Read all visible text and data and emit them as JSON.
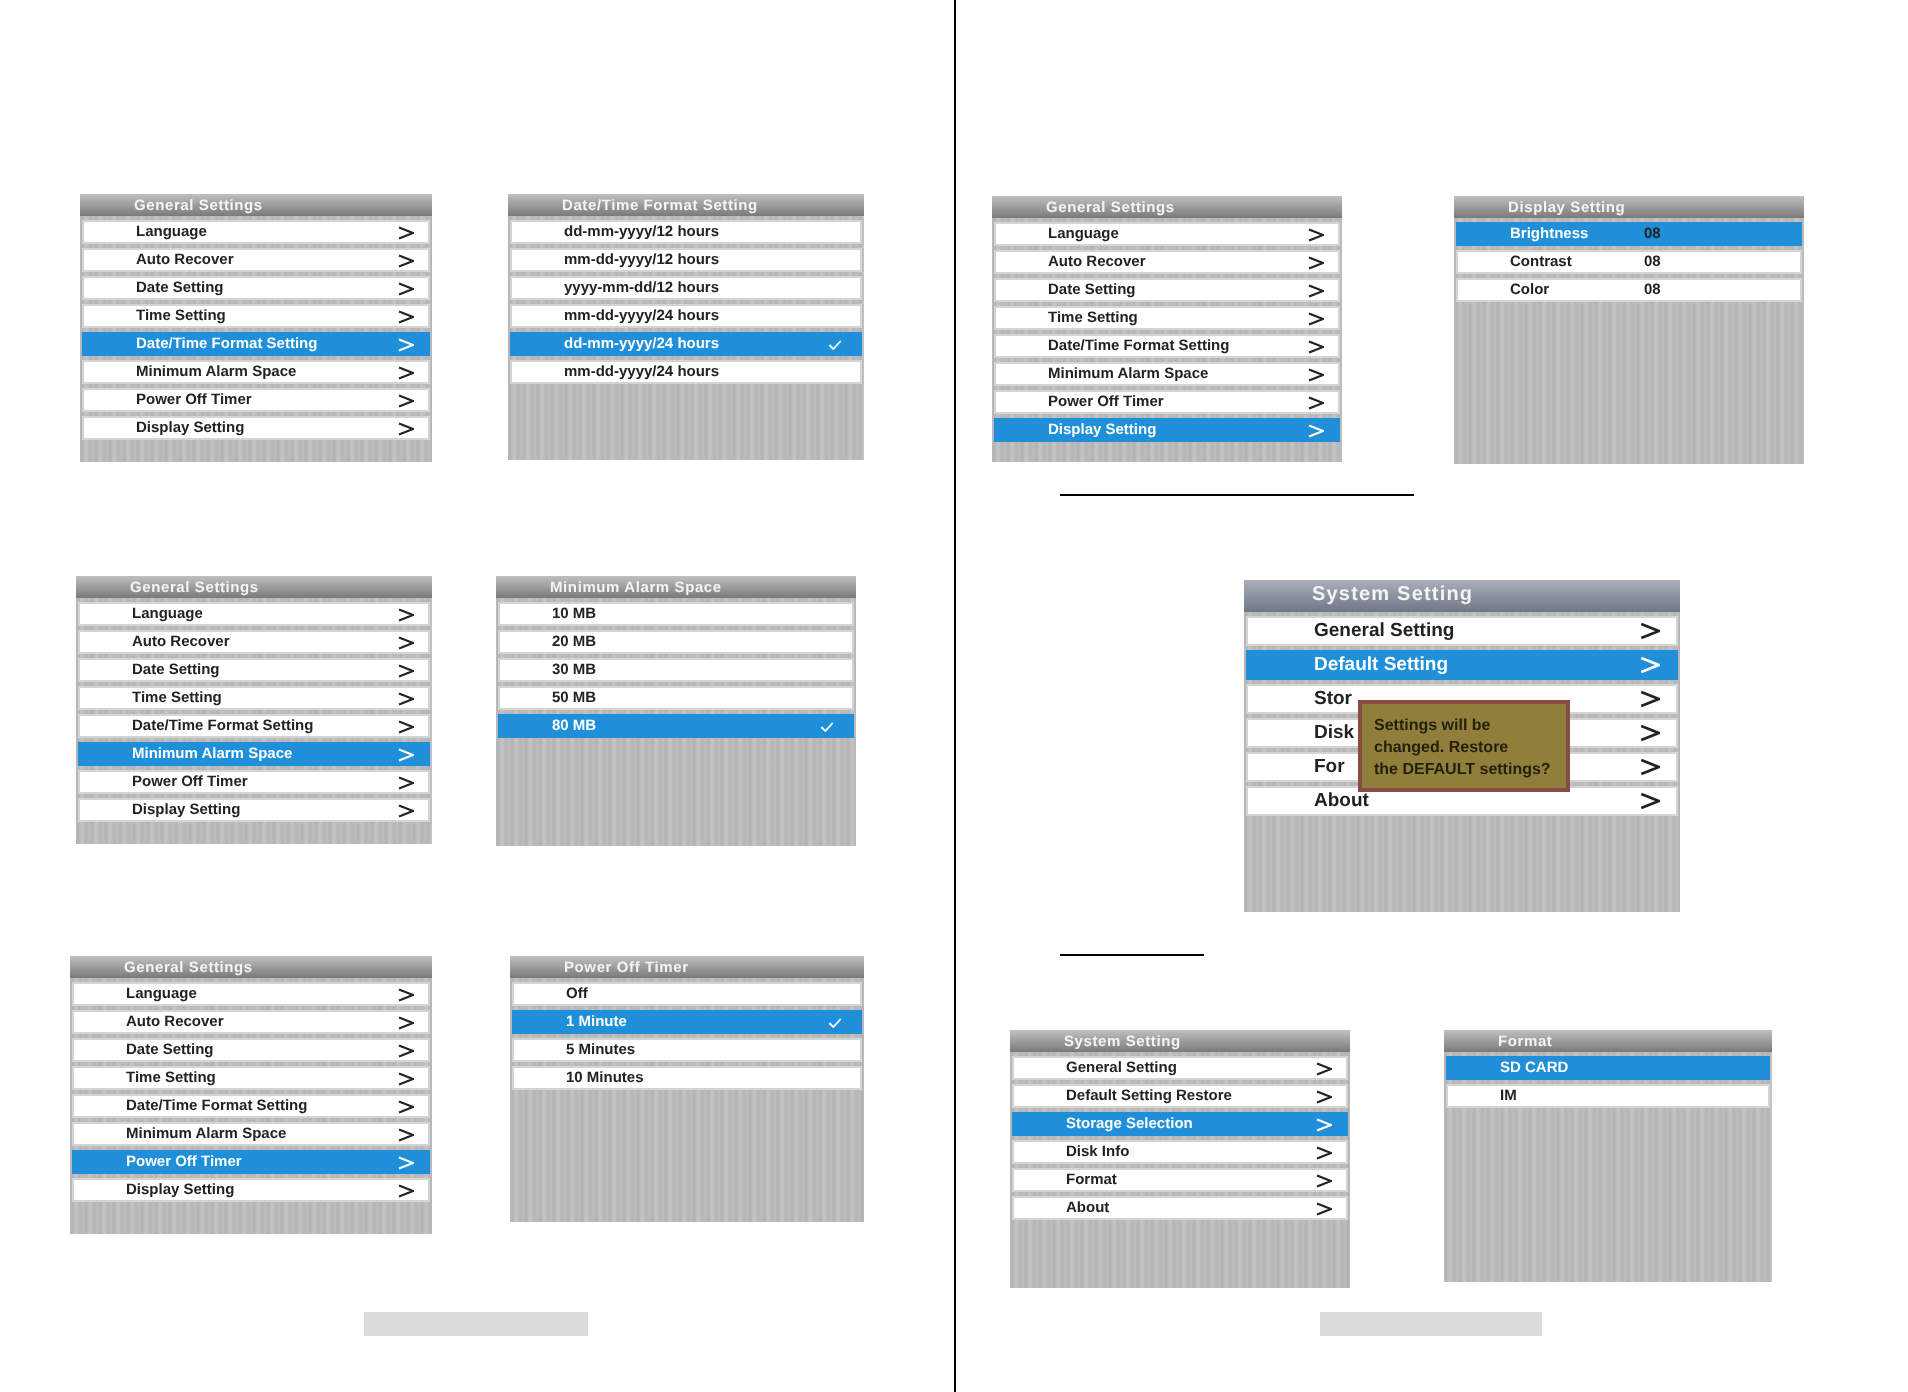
{
  "left_page": {
    "screens": [
      {
        "kind": "menu",
        "title": "General Settings",
        "items": [
          {
            "label": "Language",
            "selected": false
          },
          {
            "label": "Auto Recover",
            "selected": false
          },
          {
            "label": "Date Setting",
            "selected": false
          },
          {
            "label": "Time Setting",
            "selected": false
          },
          {
            "label": "Date/Time Format Setting",
            "selected": true
          },
          {
            "label": "Minimum Alarm Space",
            "selected": false
          },
          {
            "label": "Power Off Timer",
            "selected": false
          },
          {
            "label": "Display Setting",
            "selected": false
          }
        ]
      },
      {
        "kind": "options",
        "title": "Date/Time Format Setting",
        "items": [
          {
            "label": "dd-mm-yyyy/12 hours",
            "selected": false,
            "checked": false
          },
          {
            "label": "mm-dd-yyyy/12 hours",
            "selected": false,
            "checked": false
          },
          {
            "label": "yyyy-mm-dd/12 hours",
            "selected": false,
            "checked": false
          },
          {
            "label": "mm-dd-yyyy/24 hours",
            "selected": false,
            "checked": false
          },
          {
            "label": "dd-mm-yyyy/24 hours",
            "selected": true,
            "checked": true
          },
          {
            "label": "mm-dd-yyyy/24 hours",
            "selected": false,
            "checked": false
          }
        ]
      },
      {
        "kind": "menu",
        "title": "General Settings",
        "items": [
          {
            "label": "Language",
            "selected": false
          },
          {
            "label": "Auto Recover",
            "selected": false
          },
          {
            "label": "Date Setting",
            "selected": false
          },
          {
            "label": "Time Setting",
            "selected": false
          },
          {
            "label": "Date/Time Format Setting",
            "selected": false
          },
          {
            "label": "Minimum Alarm Space",
            "selected": true
          },
          {
            "label": "Power Off Timer",
            "selected": false
          },
          {
            "label": "Display Setting",
            "selected": false
          }
        ]
      },
      {
        "kind": "options",
        "title": "Minimum Alarm Space",
        "items": [
          {
            "label": "10 MB",
            "selected": false,
            "checked": false
          },
          {
            "label": "20 MB",
            "selected": false,
            "checked": false
          },
          {
            "label": "30 MB",
            "selected": false,
            "checked": false
          },
          {
            "label": "50 MB",
            "selected": false,
            "checked": false
          },
          {
            "label": "80 MB",
            "selected": true,
            "checked": true
          }
        ]
      },
      {
        "kind": "menu",
        "title": "General Settings",
        "items": [
          {
            "label": "Language",
            "selected": false
          },
          {
            "label": "Auto Recover",
            "selected": false
          },
          {
            "label": "Date Setting",
            "selected": false
          },
          {
            "label": "Time Setting",
            "selected": false
          },
          {
            "label": "Date/Time Format Setting",
            "selected": false
          },
          {
            "label": "Minimum Alarm Space",
            "selected": false
          },
          {
            "label": "Power Off Timer",
            "selected": true
          },
          {
            "label": "Display Setting",
            "selected": false
          }
        ]
      },
      {
        "kind": "options",
        "title": "Power Off Timer",
        "items": [
          {
            "label": "Off",
            "selected": false,
            "checked": false
          },
          {
            "label": "1 Minute",
            "selected": true,
            "checked": true
          },
          {
            "label": "5 Minutes",
            "selected": false,
            "checked": false
          },
          {
            "label": "10 Minutes",
            "selected": false,
            "checked": false
          }
        ]
      }
    ]
  },
  "right_page": {
    "screens": [
      {
        "kind": "menu",
        "title": "General Settings",
        "items": [
          {
            "label": "Language",
            "selected": false
          },
          {
            "label": "Auto Recover",
            "selected": false
          },
          {
            "label": "Date Setting",
            "selected": false
          },
          {
            "label": "Time Setting",
            "selected": false
          },
          {
            "label": "Date/Time Format Setting",
            "selected": false
          },
          {
            "label": "Minimum Alarm Space",
            "selected": false
          },
          {
            "label": "Power Off Timer",
            "selected": false
          },
          {
            "label": "Display Setting",
            "selected": true
          }
        ]
      },
      {
        "kind": "values",
        "title": "Display Setting",
        "items": [
          {
            "label": "Brightness",
            "value": "08",
            "selected": true
          },
          {
            "label": "Contrast",
            "value": "08",
            "selected": false
          },
          {
            "label": "Color",
            "value": "08",
            "selected": false
          }
        ]
      },
      {
        "kind": "menu",
        "title": "System Setting",
        "items": [
          {
            "label": "General Setting",
            "selected": false
          },
          {
            "label": "Default Setting",
            "selected": true
          },
          {
            "label": "Stor",
            "selected": false
          },
          {
            "label": "Disk",
            "selected": false
          },
          {
            "label": "For",
            "selected": false
          },
          {
            "label": "About",
            "selected": false
          }
        ],
        "dialog": {
          "lines": [
            "Settings will be",
            "changed. Restore",
            "the DEFAULT settings?"
          ]
        }
      },
      {
        "kind": "menu",
        "title": "System Setting",
        "items": [
          {
            "label": "General Setting",
            "selected": false
          },
          {
            "label": "Default Setting Restore",
            "selected": false
          },
          {
            "label": "Storage Selection",
            "selected": true
          },
          {
            "label": "Disk Info",
            "selected": false
          },
          {
            "label": "Format",
            "selected": false
          },
          {
            "label": "About",
            "selected": false
          }
        ]
      },
      {
        "kind": "options",
        "title": "Format",
        "items": [
          {
            "label": "SD CARD",
            "selected": true
          },
          {
            "label": "IM",
            "selected": false
          }
        ]
      }
    ]
  }
}
